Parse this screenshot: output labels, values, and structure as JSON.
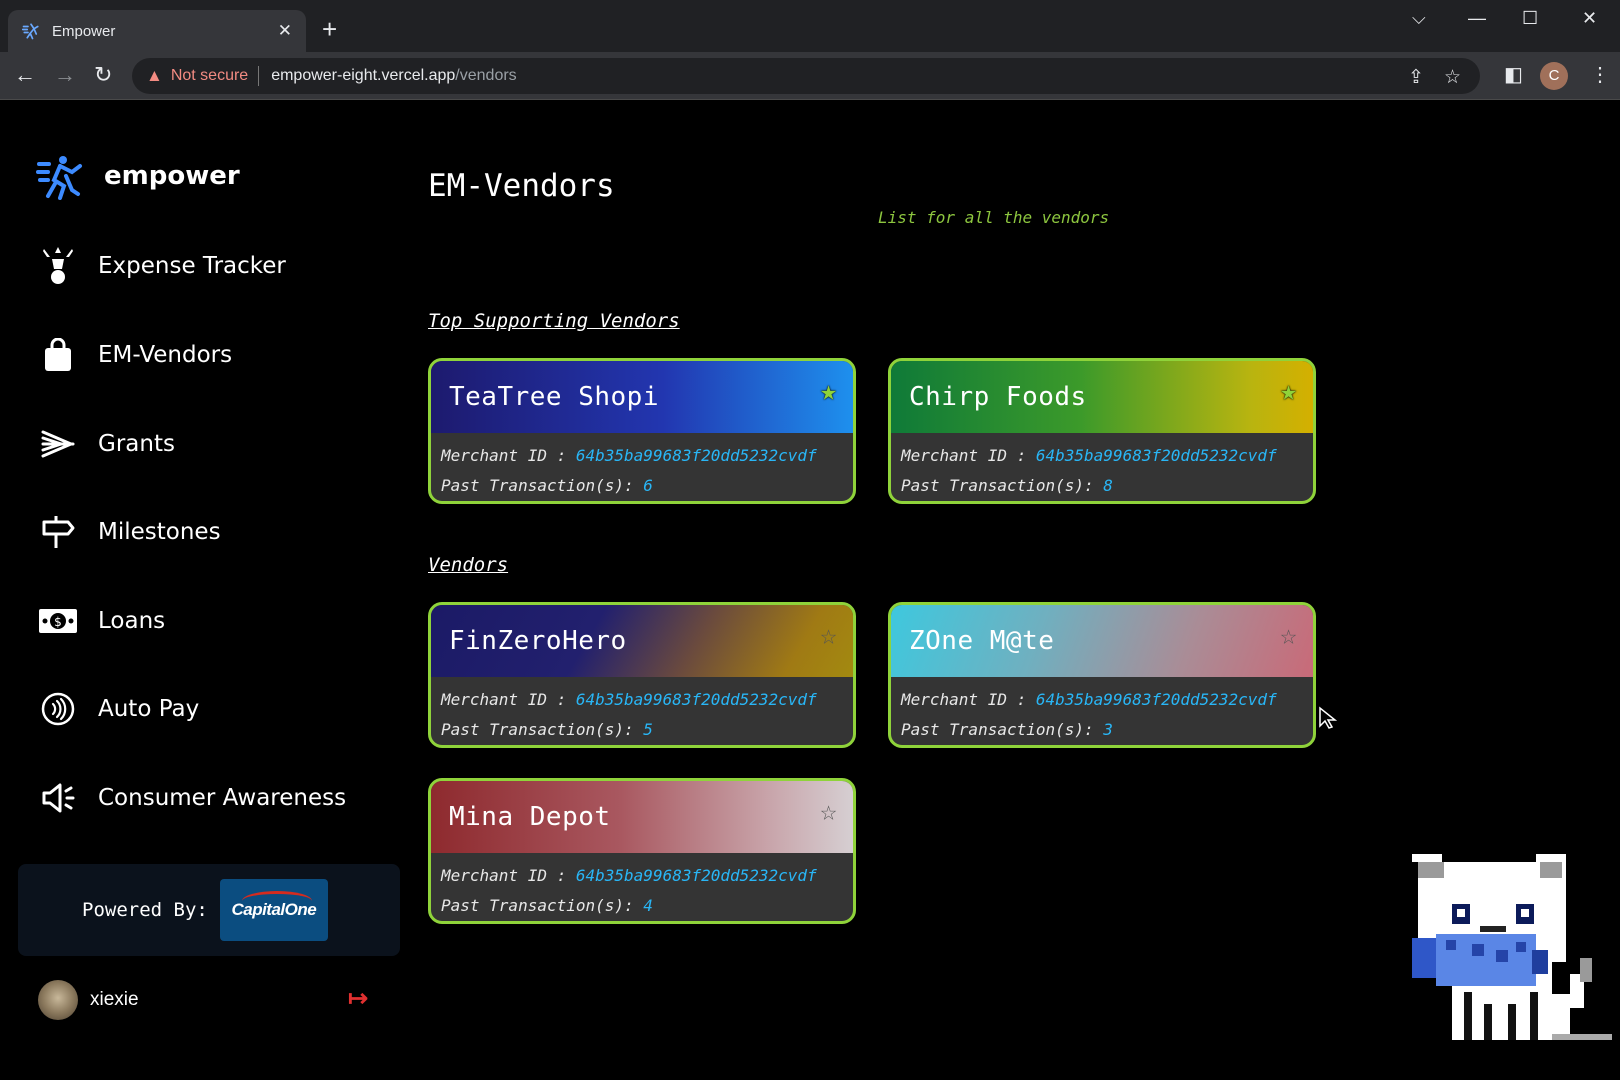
{
  "browser": {
    "tab_title": "Empower",
    "security_label": "Not secure",
    "url_host": "empower-eight.vercel.app",
    "url_path": "/vendors",
    "profile_initial": "C"
  },
  "sidebar": {
    "brand": "empower",
    "items": [
      {
        "label": "Expense Tracker",
        "icon": "expense-tracker-icon"
      },
      {
        "label": "EM-Vendors",
        "icon": "shopping-bag-icon"
      },
      {
        "label": "Grants",
        "icon": "grants-icon"
      },
      {
        "label": "Milestones",
        "icon": "signpost-icon"
      },
      {
        "label": "Loans",
        "icon": "money-icon"
      },
      {
        "label": "Auto Pay",
        "icon": "contactless-icon"
      },
      {
        "label": "Consumer Awareness",
        "icon": "megaphone-icon"
      }
    ],
    "powered_by": "Powered By:",
    "powered_logo": "CapitalOne",
    "user": "xiexie"
  },
  "main": {
    "title": "EM-Vendors",
    "subtitle": "List for all the vendors",
    "top_section": "Top Supporting Vendors",
    "vendors_section": "Vendors",
    "merchant_label": "Merchant ID :",
    "transactions_label": "Past Transaction(s):",
    "top_vendors": [
      {
        "name": "TeaTree Shopi",
        "merchant_id": "64b35ba99683f20dd5232cvdf",
        "transactions": "6",
        "starred": true
      },
      {
        "name": "Chirp Foods",
        "merchant_id": "64b35ba99683f20dd5232cvdf",
        "transactions": "8",
        "starred": true
      }
    ],
    "vendors": [
      {
        "name": "FinZeroHero",
        "merchant_id": "64b35ba99683f20dd5232cvdf",
        "transactions": "5",
        "starred": false
      },
      {
        "name": "ZOne M@te",
        "merchant_id": "64b35ba99683f20dd5232cvdf",
        "transactions": "3",
        "starred": false
      },
      {
        "name": "Mina Depot",
        "merchant_id": "64b35ba99683f20dd5232cvdf",
        "transactions": "4",
        "starred": false
      }
    ]
  },
  "colors": {
    "accent_green": "#8fd33a",
    "id_blue": "#29b6f6",
    "brand_blue": "#3d8bff",
    "logout_red": "#e03030"
  }
}
